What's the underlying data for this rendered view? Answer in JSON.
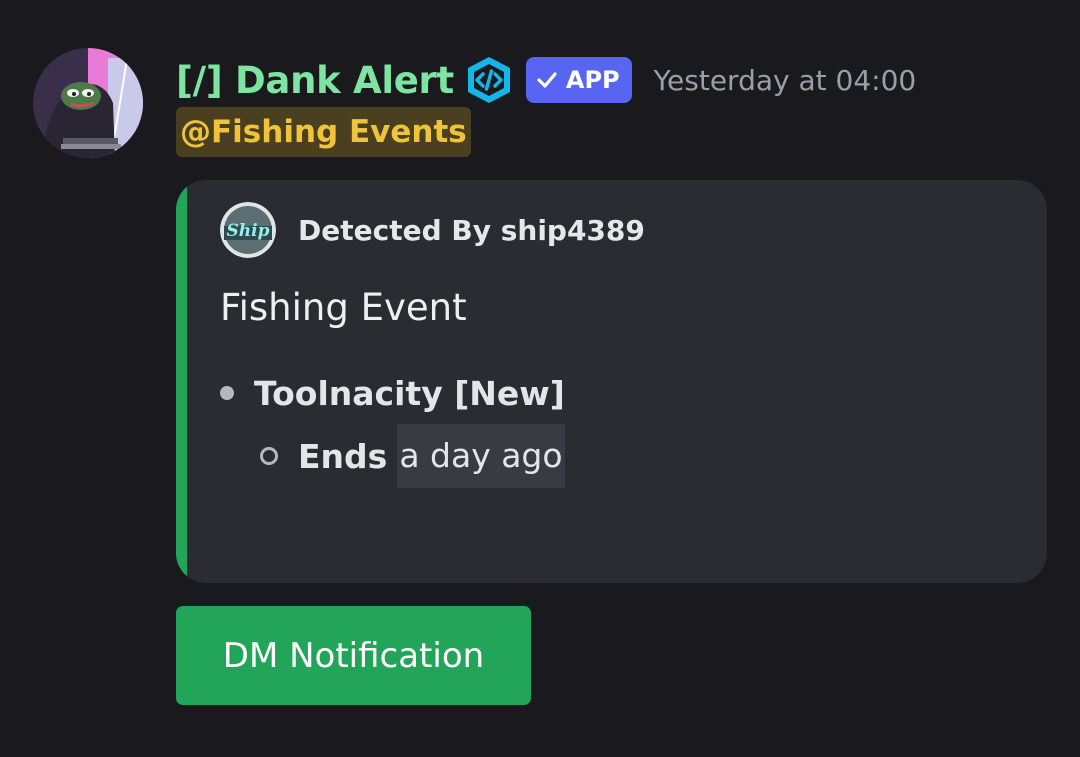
{
  "message": {
    "author": {
      "username": "[/] Dank Alert",
      "avatar_icon": "pepe-avatar-icon",
      "developer_badge_icon": "code-badge-icon",
      "app_badge": {
        "label": "APP",
        "color": "#5865f2"
      },
      "username_color": "#7ee4a1"
    },
    "timestamp": "Yesterday at 04:00",
    "mention": {
      "text": "@Fishing Events",
      "color": "#f0c43a"
    }
  },
  "embed": {
    "accent_color": "#23a559",
    "author": {
      "icon": "ship-logo-icon",
      "logo_text": "Ship",
      "name": "Detected By ship4389"
    },
    "title": "Fishing Event",
    "items": [
      {
        "label": "Toolnacity [New]",
        "sub_items": [
          {
            "label": "Ends",
            "time": "a day ago"
          }
        ]
      }
    ]
  },
  "actions": {
    "dm_button_label": "DM Notification",
    "dm_button_color": "#23a559"
  }
}
